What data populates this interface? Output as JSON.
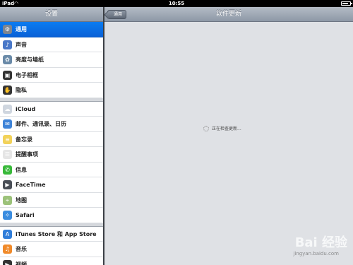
{
  "status_bar": {
    "carrier": "iPad",
    "time": "10:55"
  },
  "master": {
    "title": "设置",
    "groups": [
      [
        {
          "label": "通用",
          "icon": "gear-icon",
          "color": "#7d8591",
          "glyph": "⚙",
          "selected": true
        },
        {
          "label": "声音",
          "icon": "speaker-icon",
          "color": "#4a78c8",
          "glyph": "♪"
        },
        {
          "label": "亮度与墙纸",
          "icon": "flower-icon",
          "color": "#6a8aa8",
          "glyph": "✿"
        },
        {
          "label": "电子相框",
          "icon": "photo-frame-icon",
          "color": "#333333",
          "glyph": "▣"
        },
        {
          "label": "隐私",
          "icon": "hand-icon",
          "color": "#333333",
          "glyph": "✋"
        }
      ],
      [
        {
          "label": "iCloud",
          "icon": "cloud-icon",
          "color": "#cfd6df",
          "glyph": "☁"
        },
        {
          "label": "邮件、通讯录、日历",
          "icon": "mail-icon",
          "color": "#3f84d8",
          "glyph": "✉"
        },
        {
          "label": "备忘录",
          "icon": "notes-icon",
          "color": "#f2d25a",
          "glyph": "≡"
        },
        {
          "label": "提醒事项",
          "icon": "reminders-icon",
          "color": "#e5e5e5",
          "glyph": "☰"
        },
        {
          "label": "信息",
          "icon": "messages-icon",
          "color": "#38b93a",
          "glyph": "✆"
        },
        {
          "label": "FaceTime",
          "icon": "facetime-icon",
          "color": "#4a4f57",
          "glyph": "▶"
        },
        {
          "label": "地图",
          "icon": "maps-icon",
          "color": "#9cc27a",
          "glyph": "⌖"
        },
        {
          "label": "Safari",
          "icon": "safari-icon",
          "color": "#3b8de0",
          "glyph": "✧"
        }
      ],
      [
        {
          "label": "iTunes Store 和 App Store",
          "icon": "app-store-icon",
          "color": "#2f7dd9",
          "glyph": "A"
        },
        {
          "label": "音乐",
          "icon": "music-icon",
          "color": "#f08a2a",
          "glyph": "♫"
        },
        {
          "label": "视频",
          "icon": "video-icon",
          "color": "#333333",
          "glyph": "▶"
        }
      ]
    ]
  },
  "detail": {
    "title": "软件更新",
    "back_label": "通用",
    "status_text": "正在检查更新..."
  },
  "watermark": {
    "logo": "Bai 经验",
    "url": "jingyan.baidu.com"
  }
}
